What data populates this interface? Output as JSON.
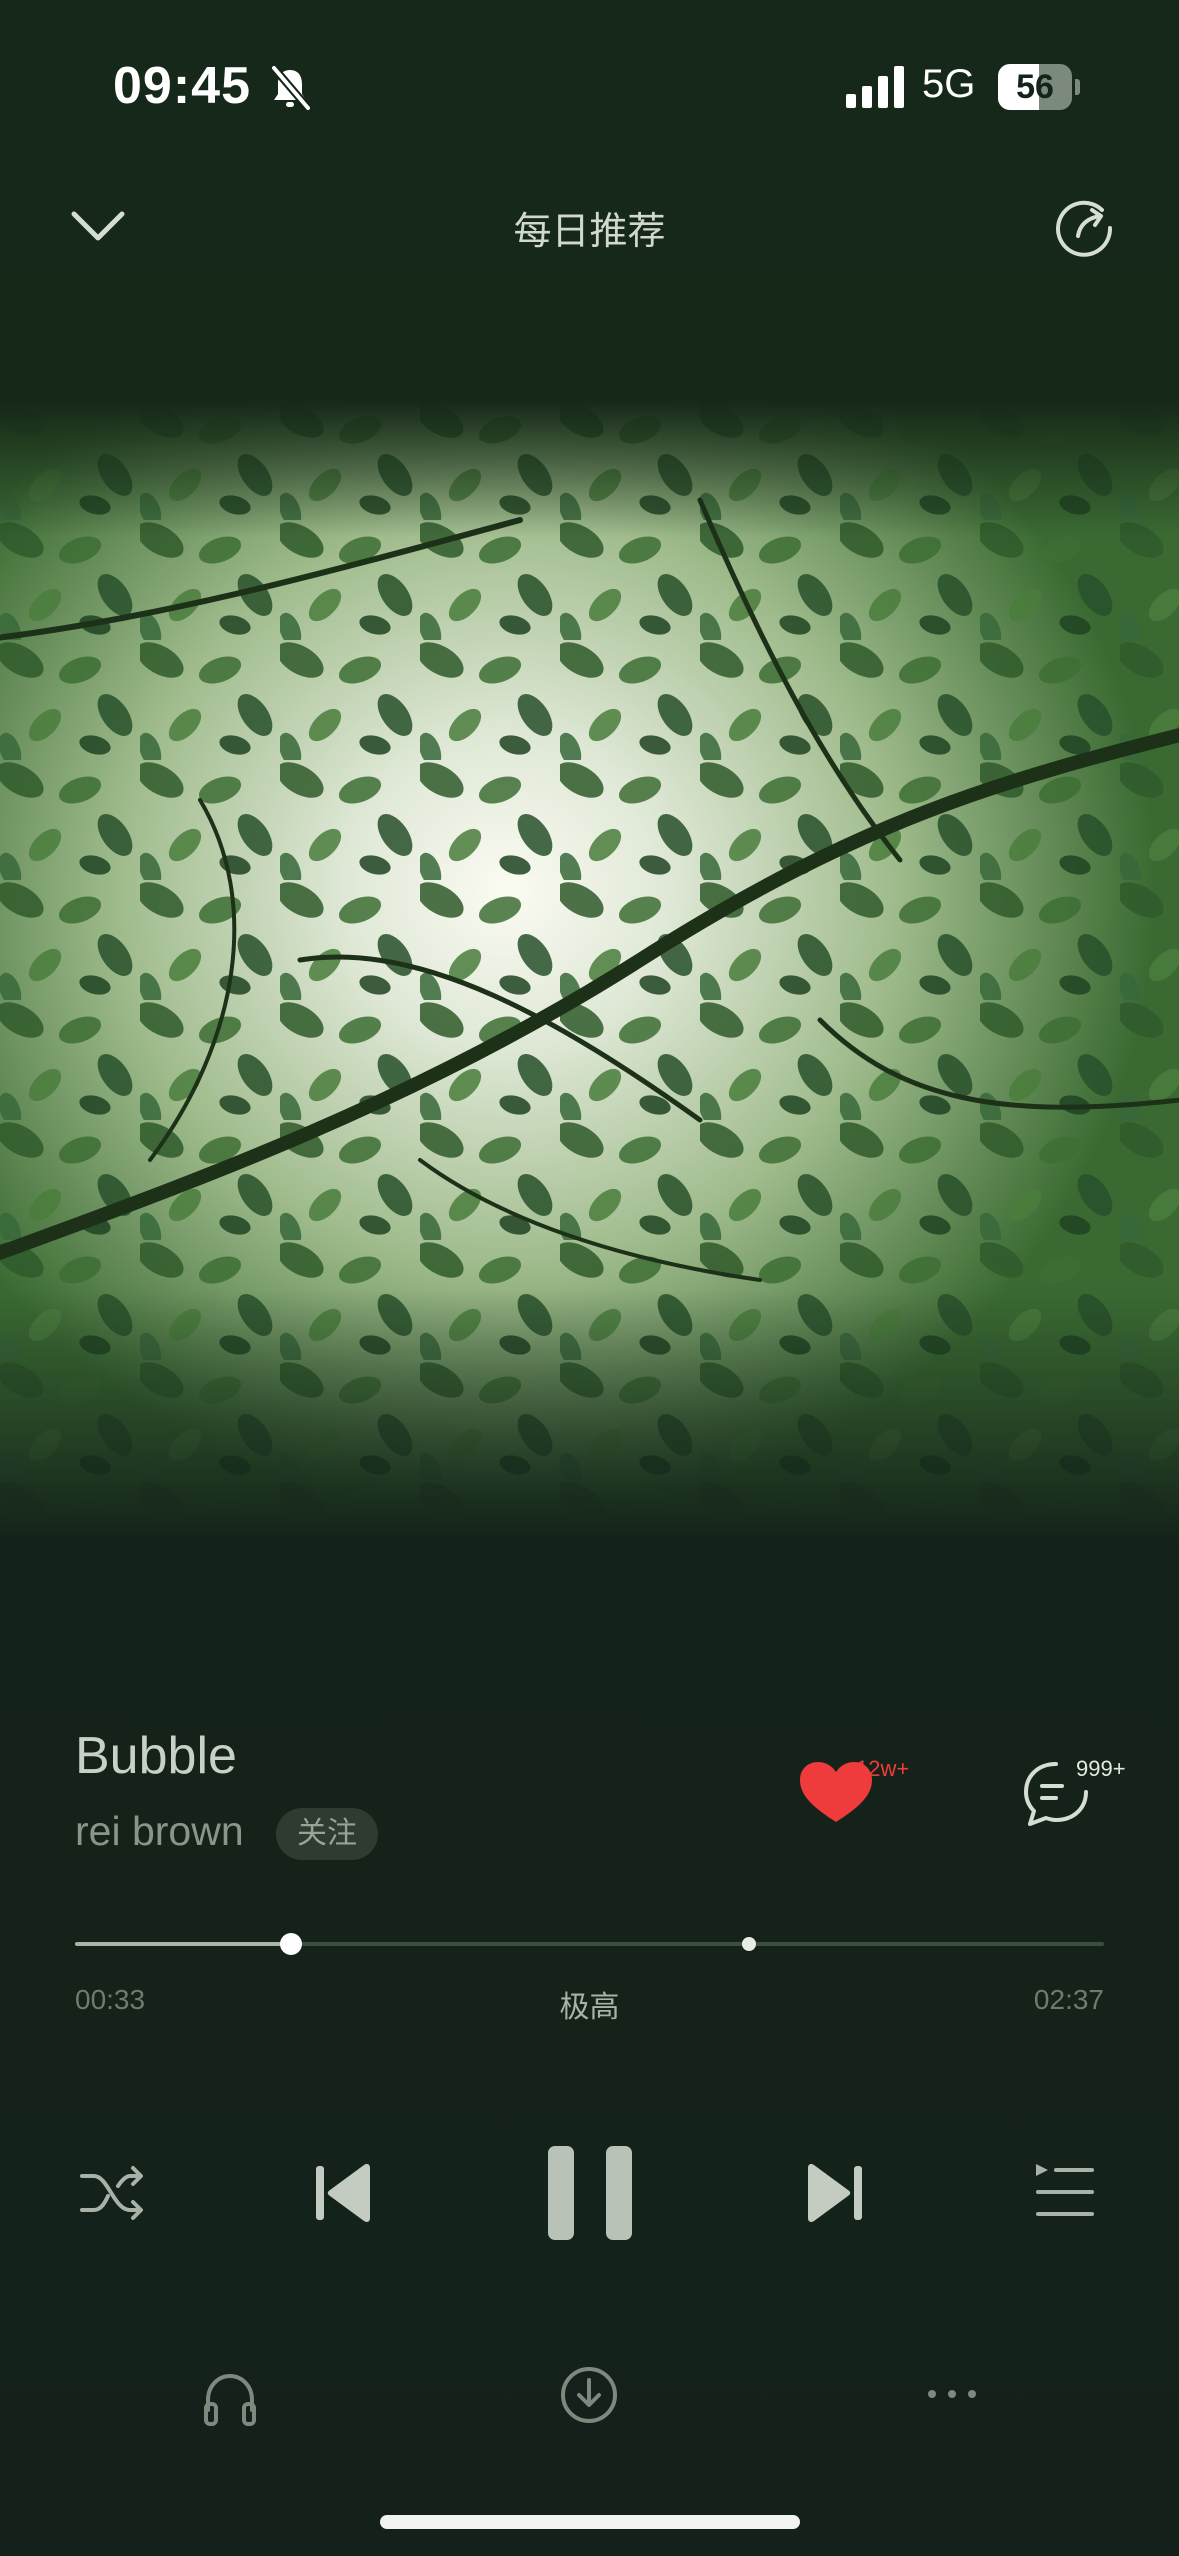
{
  "status_bar": {
    "time": "09:45",
    "network": "5G",
    "battery_level": "56",
    "battery_fraction": 0.56,
    "icons": [
      "bell-muted-icon",
      "signal-icon",
      "battery-icon"
    ]
  },
  "header": {
    "title": "每日推荐",
    "icons": [
      "chevron-down-icon",
      "share-refresh-icon"
    ]
  },
  "song": {
    "title": "Bubble",
    "artist": "rei brown",
    "follow_label": "关注"
  },
  "actions": {
    "like_count": "12w+",
    "comment_count": "999+",
    "like_color": "#ef3b3b"
  },
  "progress": {
    "current": "00:33",
    "total": "02:37",
    "quality": "极高",
    "played_fraction": 0.21,
    "buffered_fraction": 0.655
  },
  "controls": [
    "shuffle-icon",
    "previous-icon",
    "pause-icon",
    "next-icon",
    "playlist-icon"
  ],
  "bottom_actions": [
    "headphones-icon",
    "download-icon",
    "more-icon"
  ],
  "colors": {
    "background": "#15241a",
    "text": "#d8ded6",
    "muted_text": "#8a958a"
  }
}
